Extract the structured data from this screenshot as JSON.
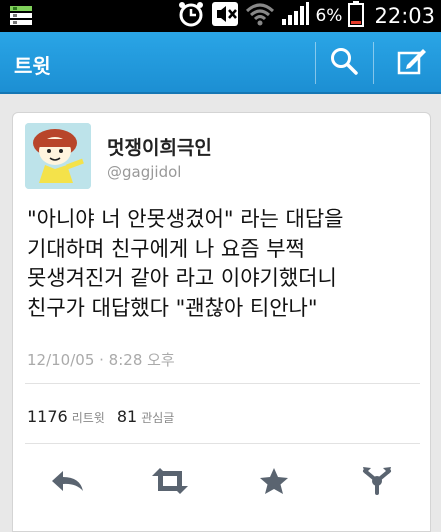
{
  "status_bar": {
    "battery_percent": "6%",
    "time": "22:03",
    "icons": [
      "notification-bars-icon",
      "alarm-icon",
      "mute-icon",
      "wifi-icon",
      "signal-icon",
      "battery-icon"
    ]
  },
  "action_bar": {
    "title": "트윗",
    "icons": [
      "search-icon",
      "compose-icon"
    ]
  },
  "tweet": {
    "author_name": "멋쟁이희극인",
    "author_handle": "@gagjidol",
    "text": "\"아니야 너 안못생겼어\" 라는 대답을\n기대하며 친구에게 나 요즘 부쩍\n못생겨진거 같아 라고 이야기했더니\n친구가 대답했다 \"괜찮아 티안나\"",
    "timestamp": "12/10/05 · 8:28 오후",
    "retweets_count": "1176",
    "retweets_label": "리트윗",
    "favorites_count": "81",
    "favorites_label": "관심글"
  },
  "actions": [
    "reply-icon",
    "retweet-icon",
    "favorite-icon",
    "share-icon"
  ],
  "colors": {
    "action_bar": "#1c8fd3",
    "status_bar": "#000000",
    "background": "#e8e8e8",
    "action_icon": "#5a6470"
  }
}
